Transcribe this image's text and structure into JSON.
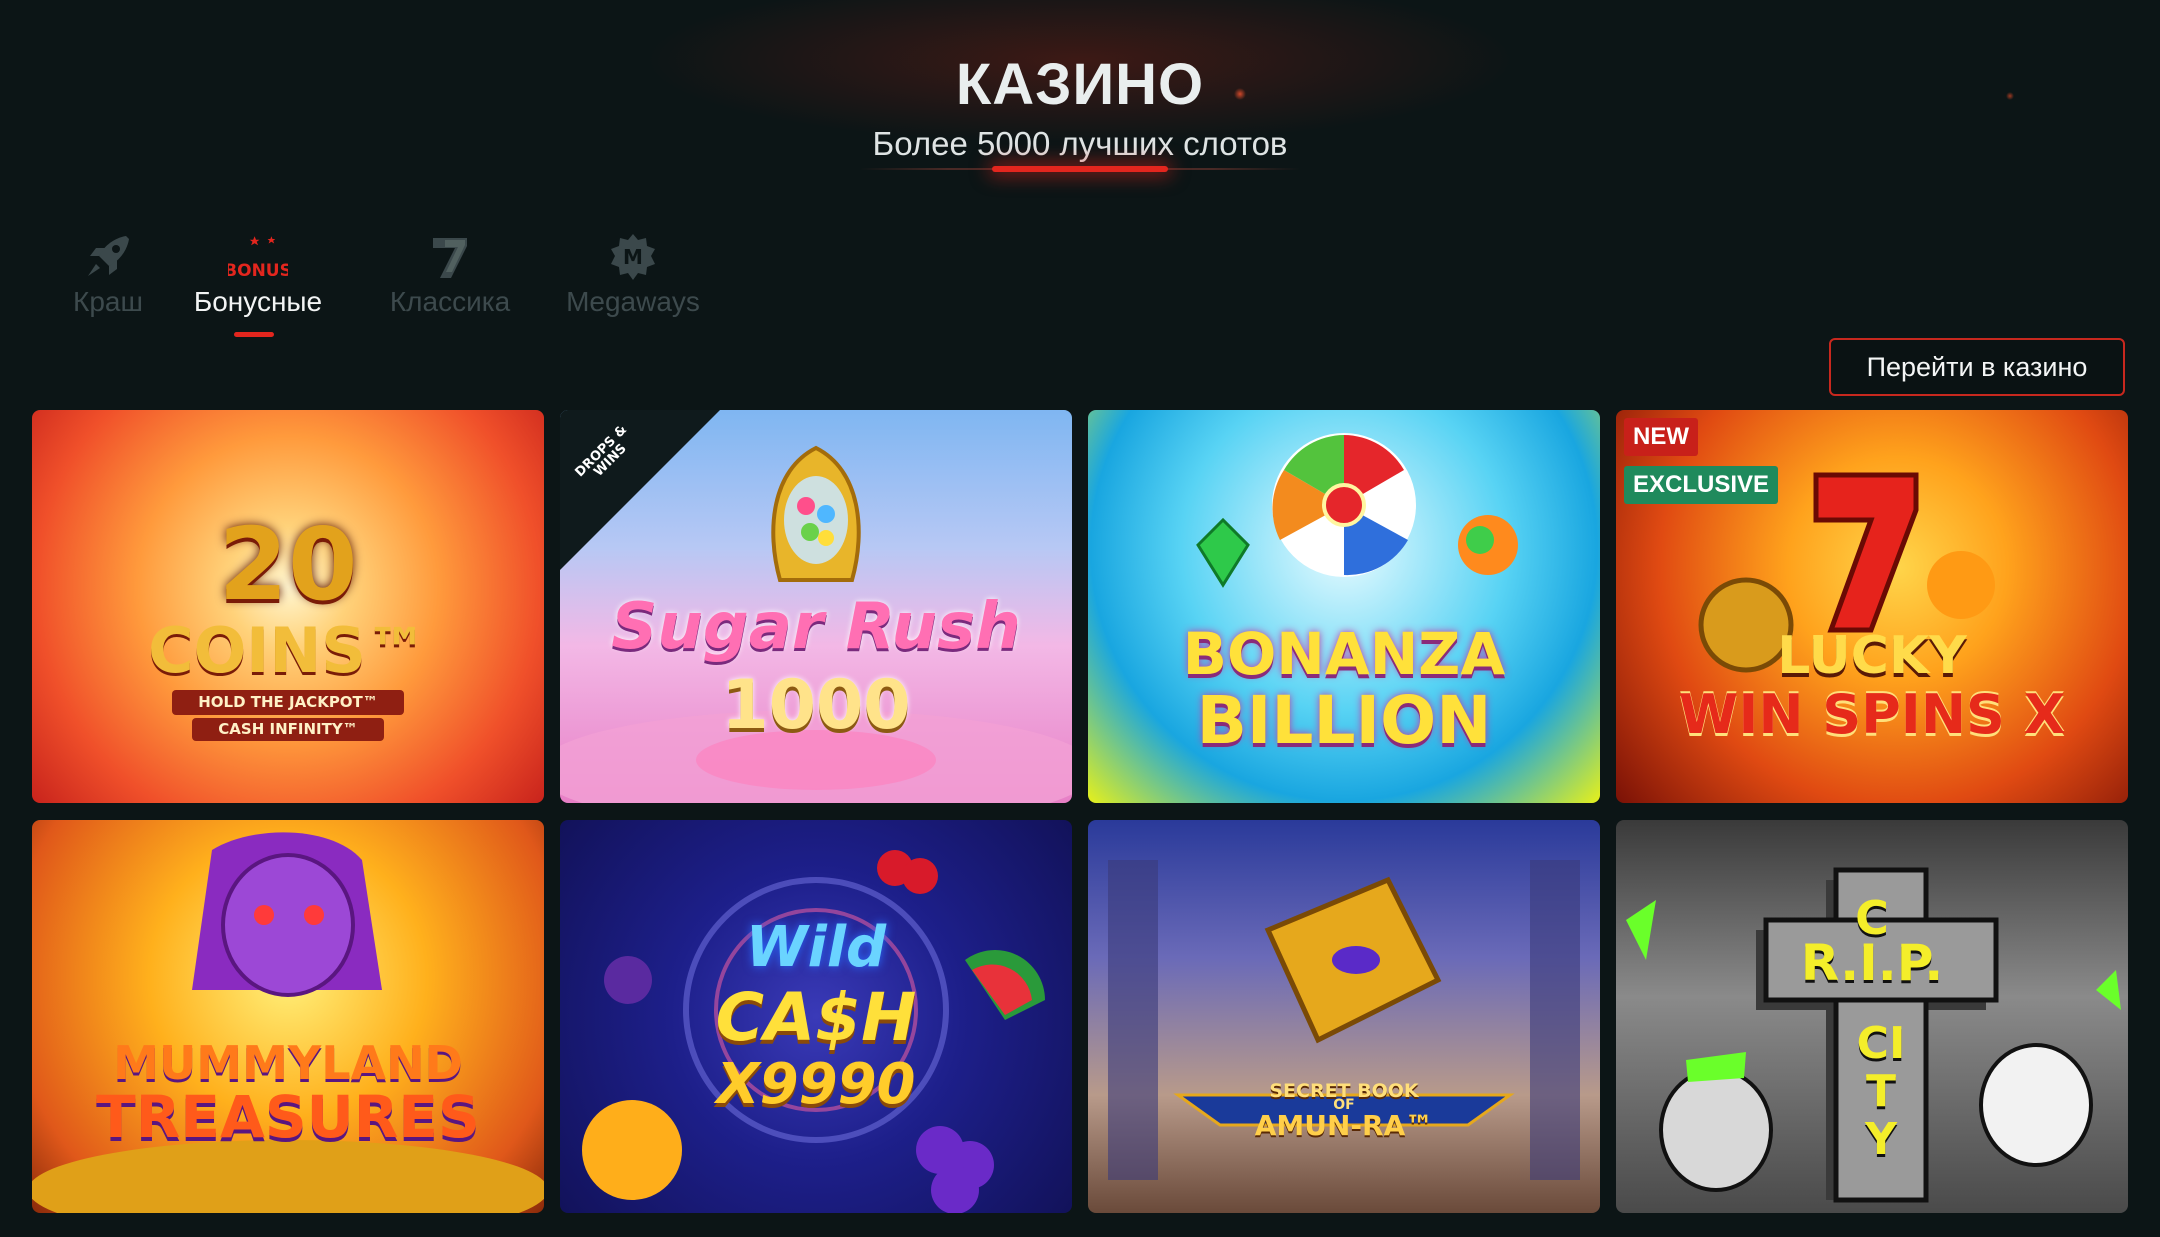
{
  "hero": {
    "title": "КАЗИНО",
    "subtitle": "Более 5000 лучших слотов"
  },
  "tabs": [
    {
      "label": "Краш",
      "icon": "rocket-icon",
      "active": false
    },
    {
      "label": "Бонусные",
      "icon": "bonus-icon",
      "icon_text": "BONUS",
      "active": true
    },
    {
      "label": "Классика",
      "icon": "seven-icon",
      "active": false
    },
    {
      "label": "Megaways",
      "icon": "megaways-icon",
      "icon_text": "M",
      "active": false
    }
  ],
  "cta_label": "Перейти в казино",
  "games": [
    {
      "title_line1": "20",
      "title_line2": "COINS™",
      "title_line3": "HOLD THE JACKPOT™",
      "title_line4": "CASH INFINITY™"
    },
    {
      "title_line1": "Sugar Rush",
      "title_line2": "1000",
      "corner_badge": "DROPS & WINS"
    },
    {
      "title_line1": "BONANZA",
      "title_line2": "BILLION"
    },
    {
      "title_line1": "LUCKY",
      "title_line2": "WIN SPINS X",
      "badge_new": "NEW",
      "badge_exclusive": "EXCLUSIVE"
    },
    {
      "title_line1": "MUMMYLAND",
      "title_line2": "TREASURES"
    },
    {
      "title_line1": "Wild",
      "title_line2": "CA$H",
      "title_line3": "X9990"
    },
    {
      "title_line1": "SECRET BOOK",
      "title_line2": "OF",
      "title_line3": "AMUN-RA™"
    },
    {
      "title_line1": "C",
      "title_line2": "R.I.P.",
      "title_line3": "CITY"
    }
  ],
  "colors": {
    "background": "#0c1516",
    "accent": "#e3261e",
    "badge_new": "#c8201a",
    "badge_exclusive": "#1f8a5c"
  }
}
